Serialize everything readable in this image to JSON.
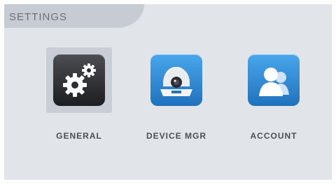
{
  "header": {
    "title": "SETTINGS"
  },
  "tiles": [
    {
      "label": "GENERAL",
      "icon": "gears-icon",
      "selected": true
    },
    {
      "label": "DEVICE MGR",
      "icon": "dome-camera-icon",
      "selected": false
    },
    {
      "label": "ACCOUNT",
      "icon": "users-icon",
      "selected": false
    }
  ],
  "colors": {
    "panel_bg": "#e1e4e9",
    "header_tab": "#c7cbd2",
    "selected_bg": "#c9ced6",
    "general_icon_bg": "#2c2d31",
    "blue_icon_bg": "#2b86d1"
  }
}
